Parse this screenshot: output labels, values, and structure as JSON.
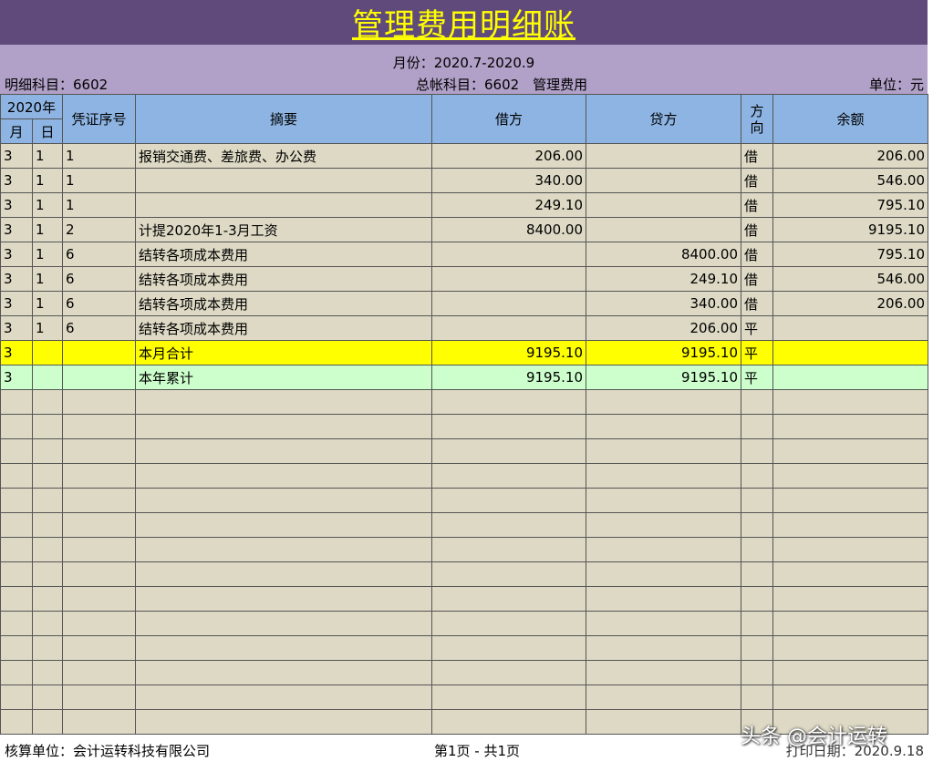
{
  "title": "管理费用明细账",
  "period": "月份：2020.7-2020.9",
  "sub_account": "明细科目：6602",
  "general_ledger": "总帐科目：6602　管理费用",
  "unit": "单位：元",
  "headers": {
    "year": "2020年",
    "month": "月",
    "day": "日",
    "voucher": "凭证序号",
    "summary": "摘要",
    "debit": "借方",
    "credit": "贷方",
    "direction": "方向",
    "balance": "余额"
  },
  "rows": [
    {
      "m": "3",
      "d": "1",
      "v": "1",
      "s": "报销交通费、差旅费、办公费",
      "dr": "206.00",
      "cr": "",
      "dir": "借",
      "bal": "206.00"
    },
    {
      "m": "3",
      "d": "1",
      "v": "1",
      "s": "",
      "dr": "340.00",
      "cr": "",
      "dir": "借",
      "bal": "546.00"
    },
    {
      "m": "3",
      "d": "1",
      "v": "1",
      "s": "",
      "dr": "249.10",
      "cr": "",
      "dir": "借",
      "bal": "795.10"
    },
    {
      "m": "3",
      "d": "1",
      "v": "2",
      "s": "计提2020年1-3月工资",
      "dr": "8400.00",
      "cr": "",
      "dir": "借",
      "bal": "9195.10"
    },
    {
      "m": "3",
      "d": "1",
      "v": "6",
      "s": "结转各项成本费用",
      "dr": "",
      "cr": "8400.00",
      "dir": "借",
      "bal": "795.10"
    },
    {
      "m": "3",
      "d": "1",
      "v": "6",
      "s": "结转各项成本费用",
      "dr": "",
      "cr": "249.10",
      "dir": "借",
      "bal": "546.00"
    },
    {
      "m": "3",
      "d": "1",
      "v": "6",
      "s": "结转各项成本费用",
      "dr": "",
      "cr": "340.00",
      "dir": "借",
      "bal": "206.00"
    },
    {
      "m": "3",
      "d": "1",
      "v": "6",
      "s": "结转各项成本费用",
      "dr": "",
      "cr": "206.00",
      "dir": "平",
      "bal": ""
    }
  ],
  "month_total": {
    "m": "3",
    "s": "本月合计",
    "dr": "9195.10",
    "cr": "9195.10",
    "dir": "平"
  },
  "year_total": {
    "m": "3",
    "s": "本年累计",
    "dr": "9195.10",
    "cr": "9195.10",
    "dir": "平"
  },
  "footer": {
    "org": "核算单位：会计运转科技有限公司",
    "page": "第1页 - 共1页",
    "print_date": "打印日期：2020.9.18"
  },
  "watermark": "头条 @会计运转",
  "colors": {
    "title_bg": "#604a7b",
    "title_text": "#ffff00",
    "subheader_bg": "#b1a0c7",
    "header_bg": "#8db4e2",
    "row_bg": "#ddd9c4",
    "month_total_bg": "#ffff00",
    "year_total_bg": "#ccffcc"
  }
}
